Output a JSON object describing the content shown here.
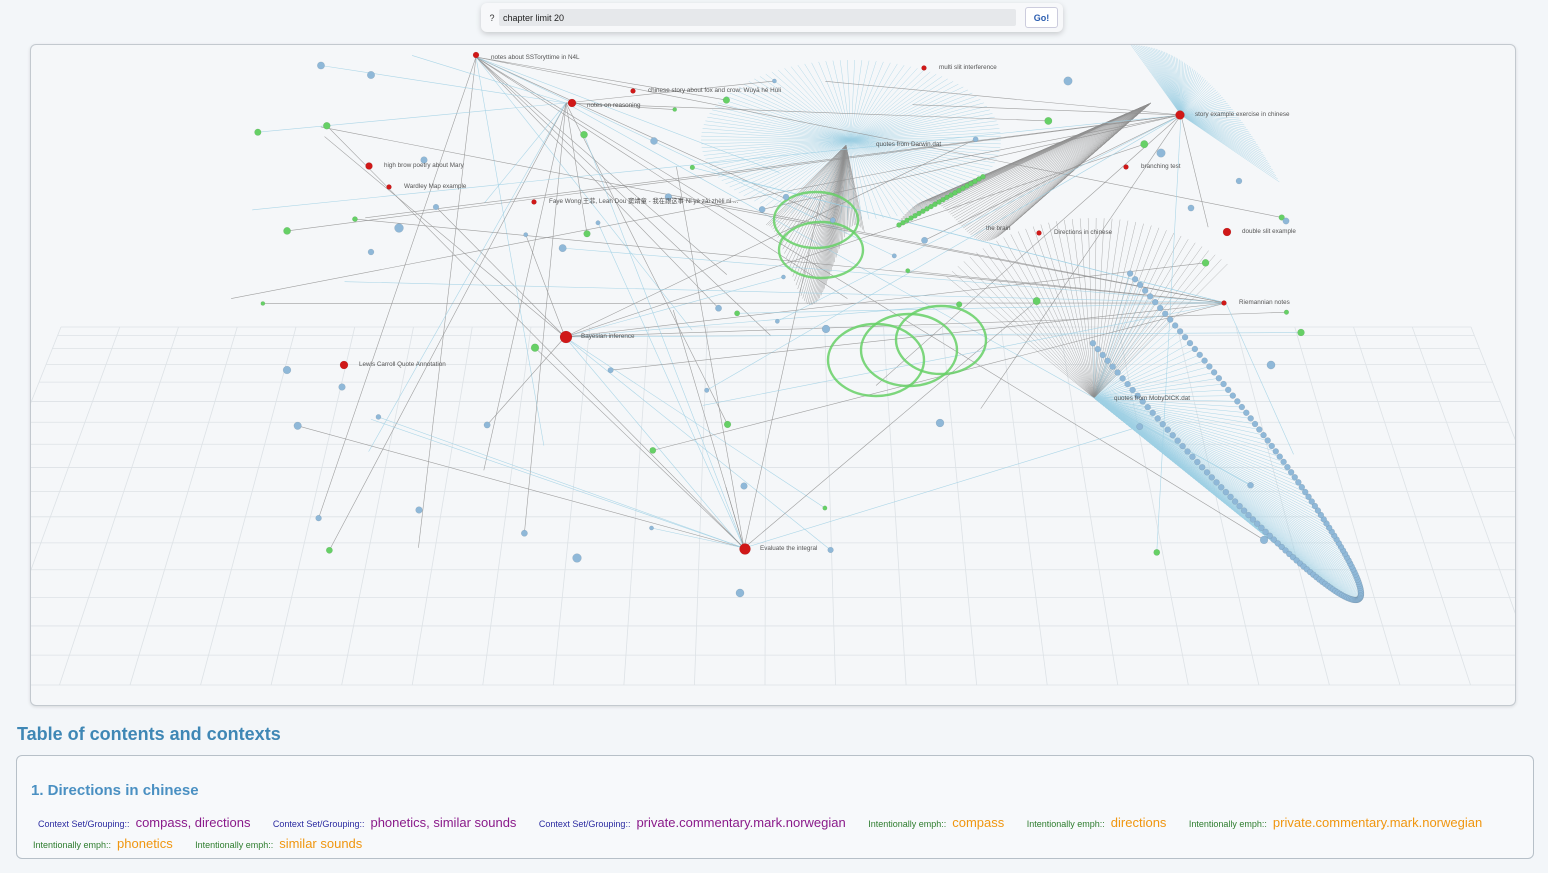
{
  "search": {
    "prompt_label": "?",
    "query": "chapter limit 20",
    "go_label": "Go!"
  },
  "graph": {
    "node_labels": [
      "notes about SSToryttime in N4L",
      "notes on reasoning",
      "chinese story about fox and crow: Wùyā hé Húli",
      "multi slit interference",
      "high brow poetry about Mary",
      "Wardley Map example",
      "Faye Wong 王菲, Leah Dou 窦靖童 - 我在跟这事 Nǐ yè zài zhèli nǐ ...",
      "quotes from Darwin.dat",
      "story example exercise in chinese",
      "branching test",
      "Directions in chinese",
      "double slit example",
      "Lewis Carroll Quote Annotation",
      "Bayesian inference",
      "Riemannian notes",
      "quotes from MobyDICK.dat",
      "Evaluate the integral",
      "the brain"
    ]
  },
  "toc": {
    "heading": "Table of contents and contexts",
    "chapter_title": "1. Directions in chinese",
    "tags": [
      {
        "kind": "ctx",
        "key": "Context Set/Grouping::",
        "value": "compass, directions"
      },
      {
        "kind": "ctx",
        "key": "Context Set/Grouping::",
        "value": "phonetics, similar sounds"
      },
      {
        "kind": "ctx",
        "key": "Context Set/Grouping::",
        "value": "private.commentary.mark.norwegian"
      },
      {
        "kind": "emph",
        "key": "Intentionally emph::",
        "value": "compass"
      },
      {
        "kind": "emph",
        "key": "Intentionally emph::",
        "value": "directions"
      },
      {
        "kind": "emph",
        "key": "Intentionally emph::",
        "value": "private.commentary.mark.norwegian"
      },
      {
        "kind": "emph",
        "key": "Intentionally emph::",
        "value": "phonetics"
      },
      {
        "kind": "emph",
        "key": "Intentionally emph::",
        "value": "similar sounds"
      }
    ]
  },
  "colors": {
    "accent": "#3f87b5",
    "node_red": "#d01818",
    "node_blue": "#8fb8d8",
    "node_green": "#66d066",
    "edge_blue": "#9fd0e4",
    "edge_gray": "#8f8f8f"
  }
}
